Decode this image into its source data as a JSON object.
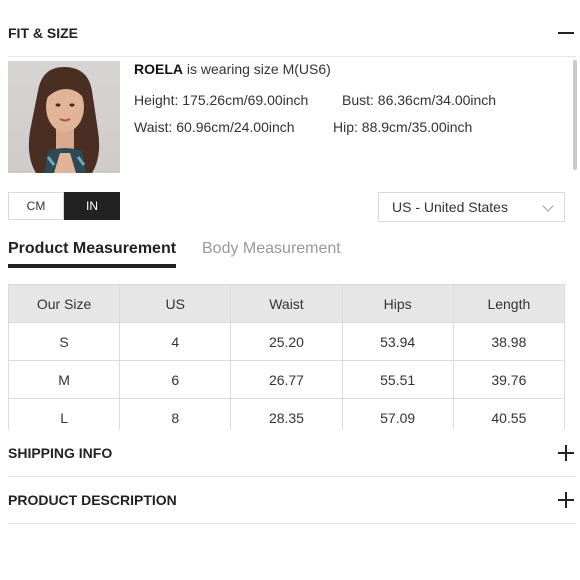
{
  "sections": {
    "fit_size": "FIT & SIZE",
    "shipping": "SHIPPING INFO",
    "description": "PRODUCT DESCRIPTION"
  },
  "model": {
    "name": "ROELA",
    "wearing": " is wearing size M(US6)",
    "height": "Height: 175.26cm/69.00inch",
    "bust": "Bust: 86.36cm/34.00inch",
    "waist": "Waist: 60.96cm/24.00inch",
    "hip": "Hip: 88.9cm/35.00inch"
  },
  "units": {
    "cm": "CM",
    "in": "IN",
    "selected": "IN"
  },
  "country": {
    "selected": "US - United States"
  },
  "tabs": {
    "product": "Product Measurement",
    "body": "Body Measurement"
  },
  "size_table": {
    "headers": [
      "Our Size",
      "US",
      "Waist",
      "Hips",
      "Length"
    ],
    "rows": [
      [
        "S",
        "4",
        "25.20",
        "53.94",
        "38.98"
      ],
      [
        "M",
        "6",
        "26.77",
        "55.51",
        "39.76"
      ],
      [
        "L",
        "8",
        "28.35",
        "57.09",
        "40.55"
      ]
    ]
  },
  "colors": {
    "text": "#222222",
    "active_button": "#222222",
    "table_header": "#e6e6e6",
    "border": "#dcdcdc"
  }
}
